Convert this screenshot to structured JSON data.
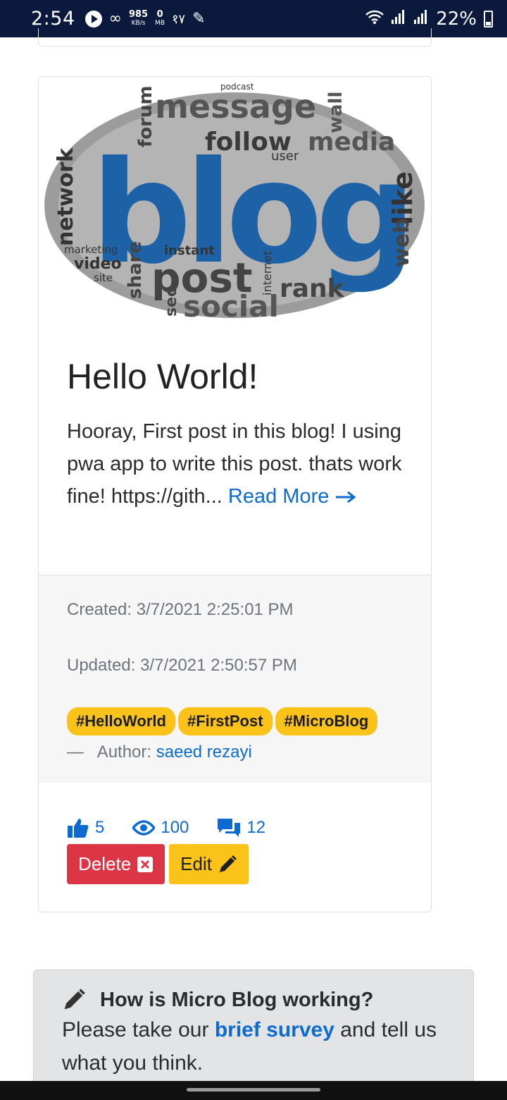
{
  "status_bar": {
    "time": "2:54",
    "net_speed": "985",
    "net_unit": "KB/s",
    "data_amount": "0",
    "data_unit": "MB",
    "extra": "१٧",
    "battery": "22%"
  },
  "post": {
    "image_words": [
      "blog",
      "message",
      "follow",
      "media",
      "post",
      "social",
      "rank",
      "network",
      "share",
      "like",
      "web",
      "video",
      "forum",
      "marketing",
      "instant",
      "user",
      "seo",
      "site",
      "wall",
      "internet",
      "podcast"
    ],
    "title": "Hello World!",
    "excerpt": "Hooray, First post in this blog! I using pwa app to write this post. thats work fine! https://gith...",
    "read_more": "Read More",
    "created": "Created: 3/7/2021 2:25:01 PM",
    "updated": "Updated: 3/7/2021 2:50:57 PM",
    "tags": [
      "#HelloWorld",
      "#FirstPost",
      "#MicroBlog"
    ],
    "author_label": "Author:",
    "author_name": "saeed rezayi",
    "likes": "5",
    "views": "100",
    "comments": "12",
    "delete_label": "Delete",
    "edit_label": "Edit"
  },
  "survey": {
    "heading": "How is Micro Blog working?",
    "text_before": "Please take our",
    "link": "brief survey",
    "text_after": "and tell us what you think."
  },
  "colors": {
    "accent": "#0d6ad0",
    "tag_yellow": "#fbc21a",
    "danger": "#dc3545",
    "status_bar": "#0b1a3c"
  }
}
